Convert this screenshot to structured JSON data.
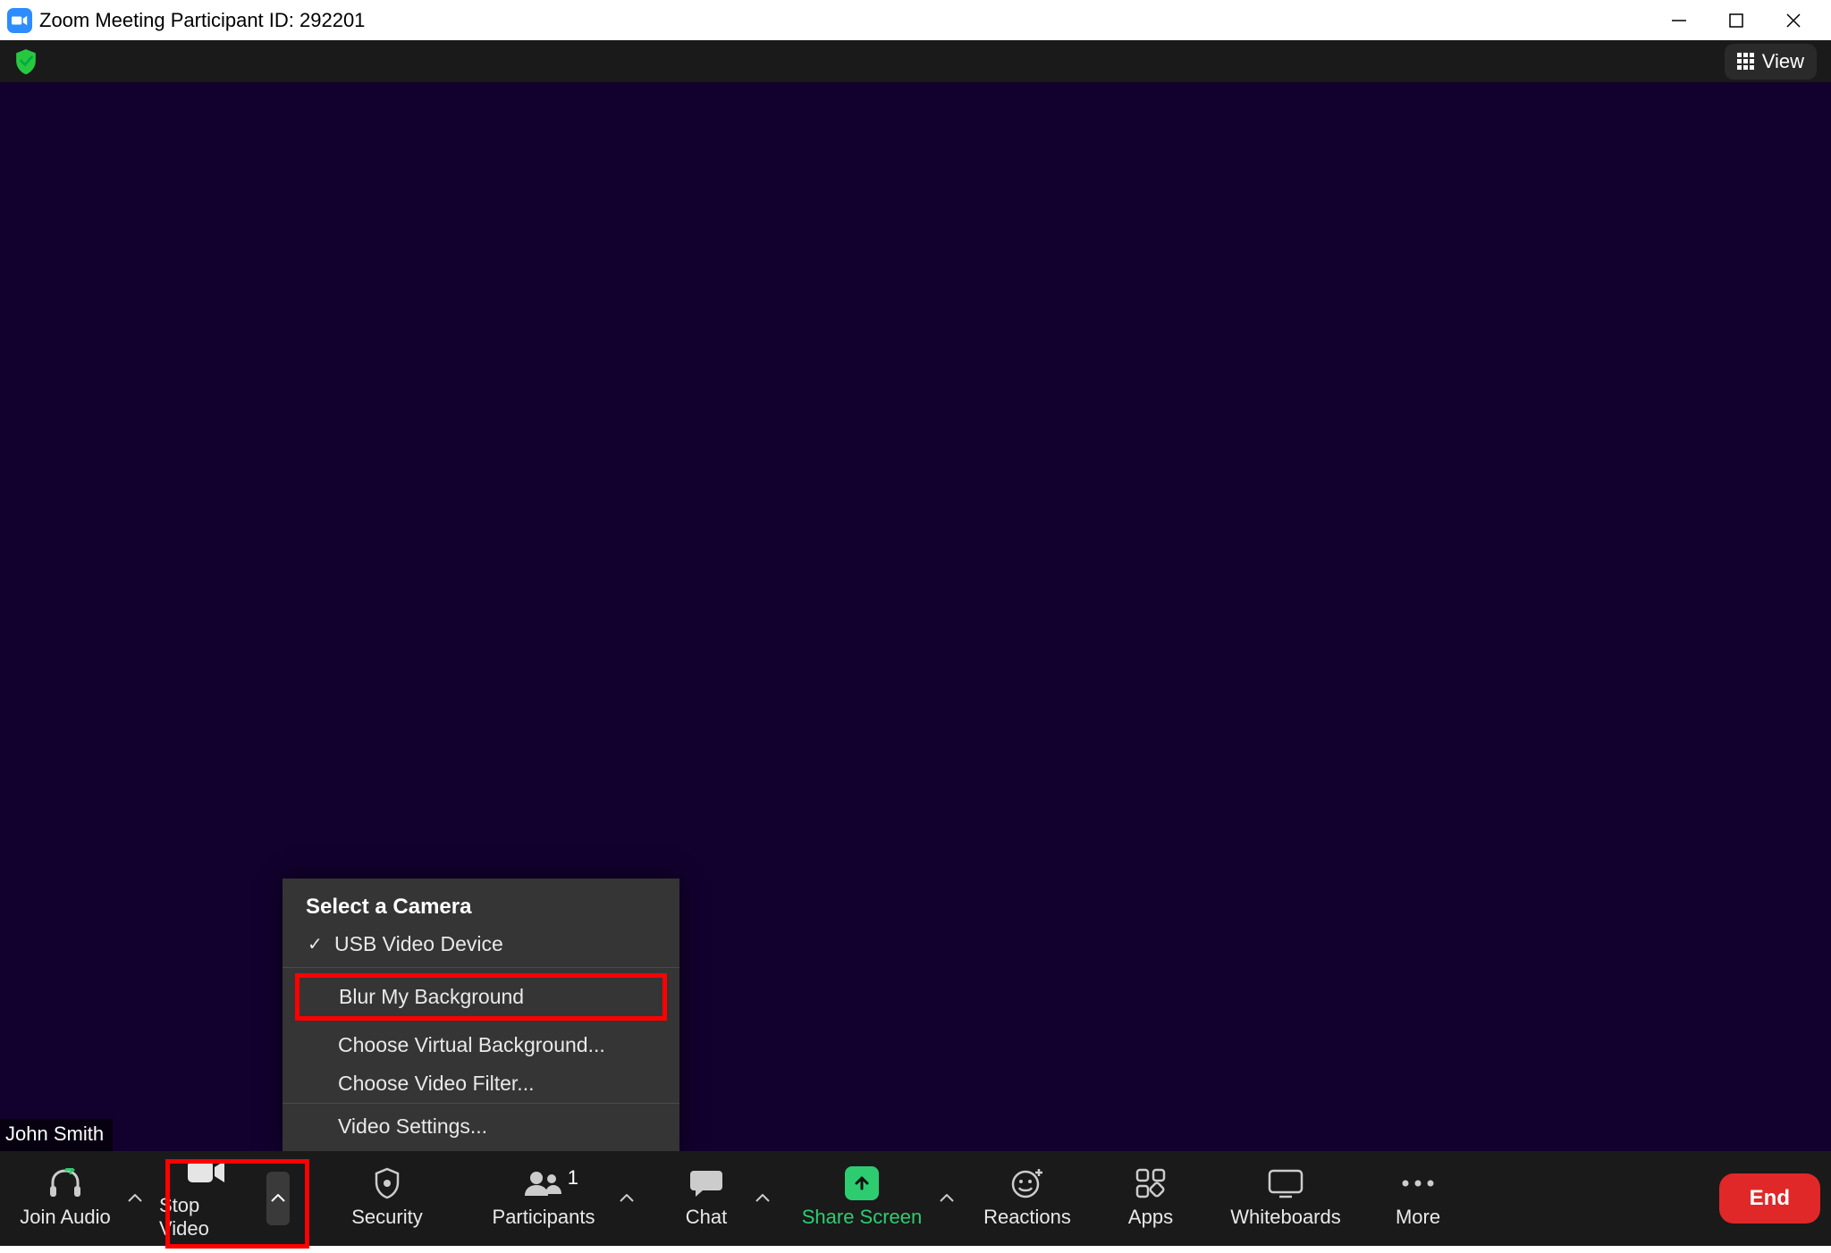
{
  "window": {
    "title": "Zoom Meeting Participant ID: 292201"
  },
  "topbar": {
    "view_label": "View"
  },
  "participant_name": "John Smith",
  "video_menu": {
    "header": "Select a Camera",
    "camera": "USB Video Device",
    "blur": "Blur My Background",
    "virtual_bg": "Choose Virtual Background...",
    "filter": "Choose Video Filter...",
    "settings": "Video Settings..."
  },
  "toolbar": {
    "join_audio": "Join Audio",
    "stop_video": "Stop Video",
    "security": "Security",
    "participants": "Participants",
    "participants_count": "1",
    "chat": "Chat",
    "share_screen": "Share Screen",
    "reactions": "Reactions",
    "apps": "Apps",
    "whiteboards": "Whiteboards",
    "more": "More",
    "end": "End"
  }
}
